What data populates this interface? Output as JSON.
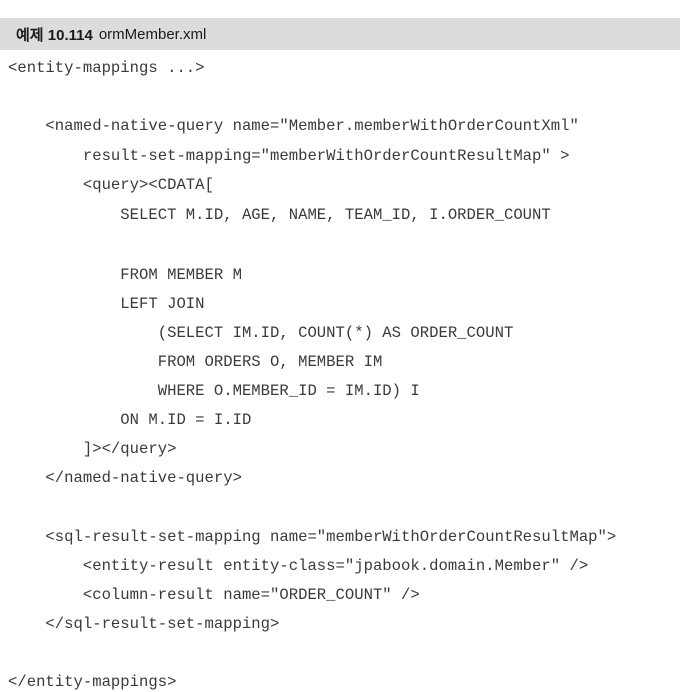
{
  "caption": {
    "label": "예제 10.114",
    "filename": "ormMember.xml"
  },
  "code_lines": [
    "<entity-mappings ...>",
    "",
    "    <named-native-query name=\"Member.memberWithOrderCountXml\"",
    "        result-set-mapping=\"memberWithOrderCountResultMap\" >",
    "        <query><CDATA[",
    "            SELECT M.ID, AGE, NAME, TEAM_ID, I.ORDER_COUNT",
    "",
    "            FROM MEMBER M",
    "            LEFT JOIN",
    "                (SELECT IM.ID, COUNT(*) AS ORDER_COUNT",
    "                FROM ORDERS O, MEMBER IM",
    "                WHERE O.MEMBER_ID = IM.ID) I",
    "            ON M.ID = I.ID",
    "        ]></query>",
    "    </named-native-query>",
    "",
    "    <sql-result-set-mapping name=\"memberWithOrderCountResultMap\">",
    "        <entity-result entity-class=\"jpabook.domain.Member\" />",
    "        <column-result name=\"ORDER_COUNT\" />",
    "    </sql-result-set-mapping>",
    "",
    "</entity-mappings>"
  ]
}
